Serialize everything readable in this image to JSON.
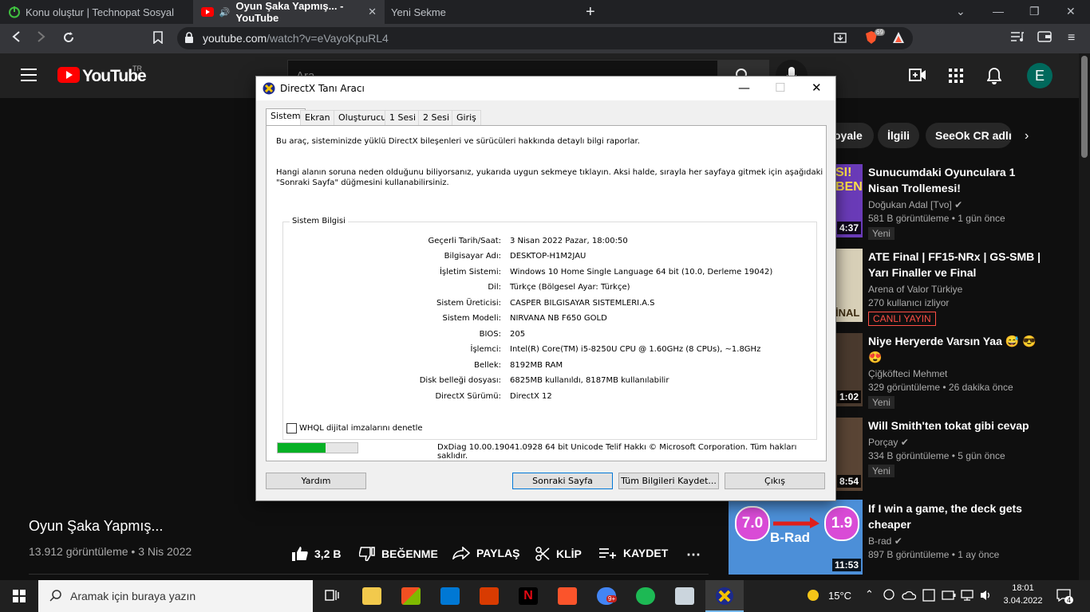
{
  "browser": {
    "tabs": [
      {
        "label": "Konu oluştur | Technopat Sosyal"
      },
      {
        "label": "Oyun Şaka Yapmış... - YouTube"
      },
      {
        "label": "Yeni Sekme"
      }
    ],
    "new_tab_label": "+",
    "url_host": "youtube.com",
    "url_path": "/watch?v=eVayoKpuRL4",
    "brave_count": "69"
  },
  "youtube": {
    "logo_text": "YouTube",
    "logo_region": "TR",
    "search_placeholder": "Ara",
    "avatar_letter": "E",
    "chips": [
      "oyale",
      "İlgili",
      "SeeOk CR adlı"
    ],
    "video_title": "Oyun Şaka Yapmış...",
    "video_meta": "13.912 görüntüleme • 3 Nis 2022",
    "actions": {
      "like_count": "3,2 B",
      "dislike": "BEĞENME",
      "share": "PAYLAŞ",
      "clip": "KLİP",
      "save": "KAYDET",
      "more": "⋯"
    },
    "related": [
      {
        "title": "Sunucumdaki Oyunculara 1 Nisan Trollemesi!",
        "channel": "Doğukan Adal [Tvo]",
        "meta": "581 B görüntüleme • 1 gün önce",
        "badge": "Yeni",
        "duration": "4:37",
        "thumb_text": "SI! BEN"
      },
      {
        "title": "ATE Final | FF15-NRx | GS-SMB | Yarı Finaller ve Final",
        "channel": "Arena of Valor Türkiye",
        "meta": "270 kullanıcı izliyor",
        "badge": "CANLI YAYIN",
        "duration": "",
        "thumb_text": "İNAL"
      },
      {
        "title": "Niye Heryerde Varsın Yaa 😅 😎 😍",
        "channel": "Çiğköfteci Mehmet",
        "meta": "329 görüntüleme • 26 dakika önce",
        "badge": "Yeni",
        "duration": "1:02",
        "thumb_text": ""
      },
      {
        "title": "Will Smith'ten tokat gibi cevap",
        "channel": "Porçay",
        "meta": "334 B görüntüleme • 5 gün önce",
        "badge": "Yeni",
        "duration": "8:54",
        "thumb_text": ""
      },
      {
        "title": "If I win a game, the deck gets cheaper",
        "channel": "B-rad",
        "meta": "897 B görüntüleme • 1 ay önce",
        "badge": "",
        "duration": "11:53",
        "thumb_text": "B-Rad",
        "thumb_left_value": "7.0",
        "thumb_right_value": "1.9"
      }
    ]
  },
  "dialog": {
    "title": "DirectX Tanı Aracı",
    "tabs": [
      "Sistem",
      "Ekran",
      "Oluşturucu",
      "1 Sesi",
      "2 Sesi",
      "Giriş"
    ],
    "intro": "Bu araç, sisteminizde yüklü DirectX bileşenleri ve sürücüleri hakkında detaylı bilgi raporlar.",
    "help_line1": "Hangi alanın soruna neden olduğunu biliyorsanız, yukarıda uygun sekmeye tıklayın. Aksi halde, sırayla her sayfaya gitmek için aşağıdaki",
    "help_line2": "\"Sonraki Sayfa\" düğmesini kullanabilirsiniz.",
    "group_title": "Sistem Bilgisi",
    "info": [
      {
        "label": "Geçerli Tarih/Saat:",
        "value": "3 Nisan 2022 Pazar, 18:00:50"
      },
      {
        "label": "Bilgisayar Adı:",
        "value": "DESKTOP-H1M2JAU"
      },
      {
        "label": "İşletim Sistemi:",
        "value": "Windows 10 Home Single Language 64 bit (10.0, Derleme 19042)"
      },
      {
        "label": "Dil:",
        "value": "Türkçe (Bölgesel Ayar: Türkçe)"
      },
      {
        "label": "Sistem Üreticisi:",
        "value": "CASPER BILGISAYAR SISTEMLERI.A.S"
      },
      {
        "label": "Sistem Modeli:",
        "value": "NIRVANA NB F650 GOLD"
      },
      {
        "label": "BIOS:",
        "value": "205"
      },
      {
        "label": "İşlemci:",
        "value": "Intel(R) Core(TM) i5-8250U CPU @ 1.60GHz (8 CPUs), ~1.8GHz"
      },
      {
        "label": "Bellek:",
        "value": "8192MB RAM"
      },
      {
        "label": "Disk belleği dosyası:",
        "value": "6825MB kullanıldı, 8187MB kullanılabilir"
      },
      {
        "label": "DirectX Sürümü:",
        "value": "DirectX 12"
      }
    ],
    "whql_label": "WHQL dijital imzalarını denetle",
    "whql_checked": false,
    "progress_fraction": 0.6,
    "footer": "DxDiag 10.00.19041.0928 64 bit Unicode  Telif Hakkı © Microsoft Corporation. Tüm hakları saklıdır.",
    "buttons": {
      "help": "Yardım",
      "next": "Sonraki Sayfa",
      "save": "Tüm Bilgileri Kaydet...",
      "exit": "Çıkış"
    }
  },
  "taskbar": {
    "search_placeholder": "Aramak için buraya yazın",
    "weather": "15°C",
    "time": "18:01",
    "date": "3.04.2022",
    "notification_count": "4",
    "extension_badge": "9+"
  },
  "colors": {
    "youtube_red": "#ff0000",
    "progress_green": "#06b025",
    "accent": "#0078d7"
  }
}
